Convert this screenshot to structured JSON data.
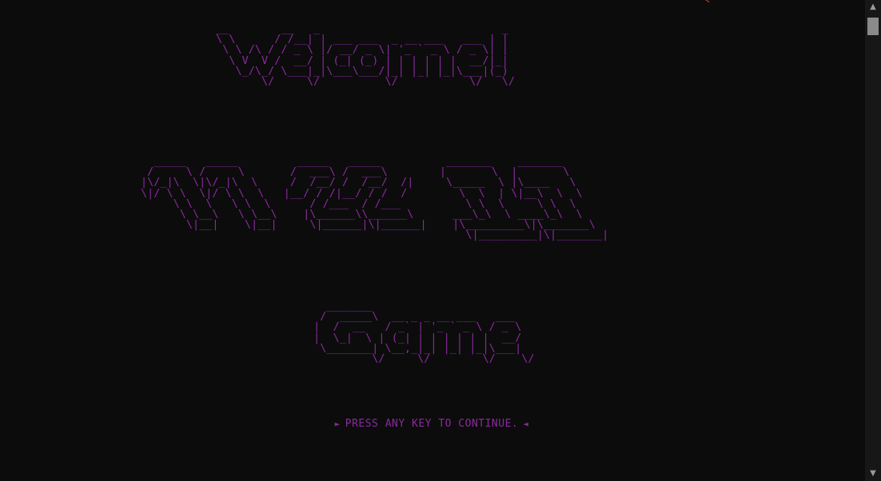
{
  "art": {
    "welcome": " __        __   _                            _ \n \\ \\      / /__| | ___ ___  _ __ ___   ___ | |\n  \\ \\ /\\ / / _ \\ |/ __/ _ \\| '_ ` _ \\ / _ \\| |\n   \\ V  V /  __/ | (_| (_) | | | | | |  __/|_|\n    \\_/\\_/ \\___|_|\\___\\___/|_| |_| |_|\\___|(_)\n        \\/     \\/          \\/           \\/   \\/",
    "title": "  _____   _____         _____   _____          _______    _______  \n /     \\ /     \\       /  ___\\ /  ___\\        |       \\  |       \\ \n|\\/_|\\  \\|\\/_|\\  \\     /  /__/ /  /__/  /|     \\_____  \\ |\\____   \\\n\\|/ \\ \\  \\|/ \\ \\  \\   |__/ / /|__/ / /  /        \\  \\  | \\|__\\  \\  \\\n     \\ \\  \\   \\ \\  \\      / /___  / /___          \\ \\  \\     \\ \\  \\ \n      \\ \\__\\   \\ \\__\\    |\\______\\\\______\\      ___\\_\\  \\ ____\\_\\  \\\n       \\|__|    \\|__|     \\|______|\\|______|    |\\_________\\|\\_______\\\n                                                  \\|_________|\\|_______|",
    "game": "   _______\n  /  _____\\  __ _ _ __ ___   ___ \n |  /  __   / _` | '_ ` _ \\ / _ \\\n |  \\_|  \\ | (_| | | | | | |  __/\n  \\_______| \\__,_|_| |_| |_|\\___|\n          \\/     \\/        \\/    \\/"
  },
  "prompt": {
    "left_arrow": "►",
    "text": "PRESS ANY KEY TO CONTINUE.",
    "right_arrow": "◄"
  },
  "scrollbar": {
    "up_icon": "▲",
    "down_icon": "▼"
  },
  "colors": {
    "background": "#0c0c0c",
    "text": "#8a2a9e"
  }
}
